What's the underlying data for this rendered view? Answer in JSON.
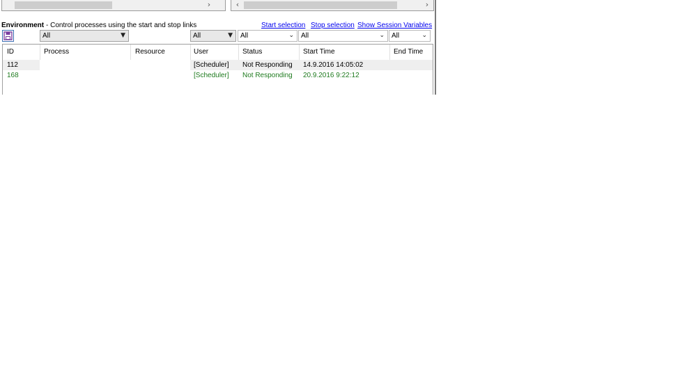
{
  "panel": {
    "title": "Environment",
    "description": "- Control processes using the start and stop links"
  },
  "links": {
    "start_selection": "Start selection",
    "stop_selection": "Stop selection",
    "show_session_variables": "Show Session Variables"
  },
  "filters": {
    "process": "All",
    "user": "All",
    "status": "All",
    "start_time": "All",
    "end_time": "All"
  },
  "columns": {
    "id": "ID",
    "process": "Process",
    "resource": "Resource",
    "user": "User",
    "status": "Status",
    "start_time": "Start Time",
    "end_time": "End Time"
  },
  "rows": [
    {
      "id": "112",
      "process": "",
      "resource": "",
      "user": "[Scheduler]",
      "status": "Not Responding",
      "start_time": "14.9.2016 14:05:02",
      "end_time": "",
      "color": "#000000"
    },
    {
      "id": "168",
      "process": "",
      "resource": "",
      "user": "[Scheduler]",
      "status": "Not Responding",
      "start_time": "20.9.2016 9:22:12",
      "end_time": "",
      "color": "#1e7a1e"
    }
  ],
  "icons": {
    "save": "save-icon",
    "scroll_left": "chevron-left-icon",
    "scroll_right": "chevron-right-icon",
    "dropdown": "caret-down-icon"
  },
  "colors": {
    "link": "#0000ee",
    "row_alt": "#efefef",
    "row_green": "#1e7a1e"
  }
}
